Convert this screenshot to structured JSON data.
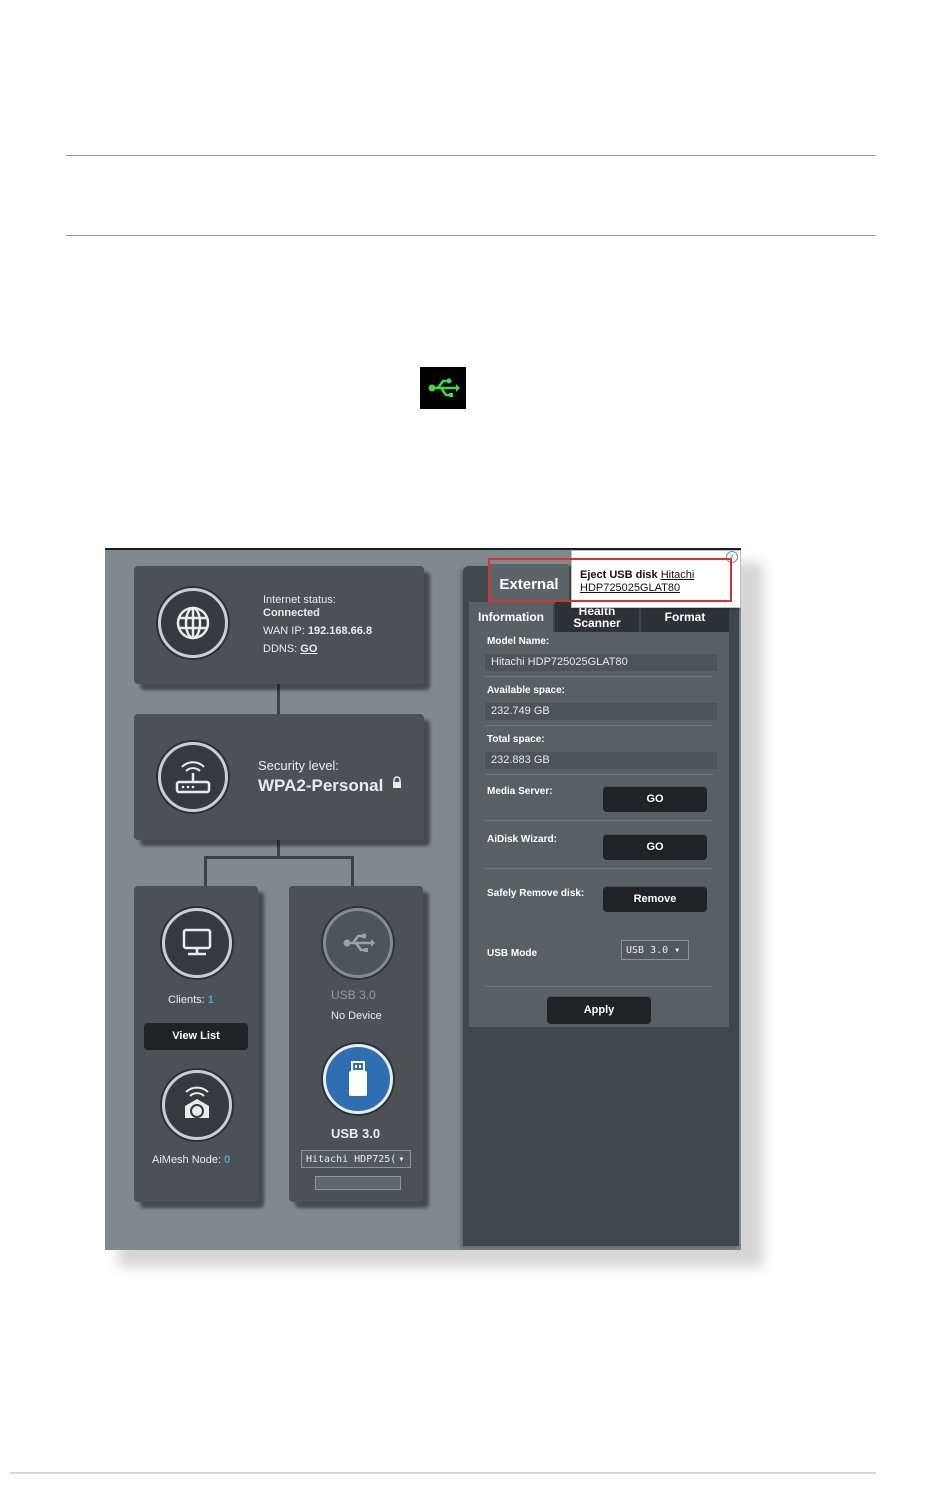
{
  "document": {
    "usb_icon": "usb-icon"
  },
  "network_map": {
    "internet": {
      "status_label": "Internet status:",
      "status_value": "Connected",
      "wan_label": "WAN IP:",
      "wan_value": "192.168.66.8",
      "ddns_label": "DDNS:",
      "ddns_value": "GO"
    },
    "router": {
      "security_label": "Security level:",
      "security_value": "WPA2-Personal"
    },
    "clients": {
      "label": "Clients:",
      "count": "1",
      "view_list": "View List"
    },
    "aimesh": {
      "label": "AiMesh Node:",
      "count": "0"
    },
    "usb_port_1": {
      "label": "USB 3.0",
      "status": "No Device"
    },
    "usb_port_2": {
      "label": "USB 3.0",
      "device_select": "Hitachi HDP725("
    }
  },
  "external": {
    "title": "External",
    "tooltip": {
      "action": "Eject USB disk",
      "device_name_1": "Hitachi",
      "device_name_2": "HDP725025GLAT80"
    },
    "tabs": [
      "Information",
      "Health Scanner",
      "Format"
    ],
    "fields": {
      "model_name_label": "Model Name:",
      "model_name_value": "Hitachi HDP725025GLAT80",
      "available_label": "Available space:",
      "available_value": "232.749 GB",
      "total_label": "Total space:",
      "total_value": "232.883 GB"
    },
    "actions": {
      "media_server_label": "Media Server:",
      "media_server_button": "GO",
      "aidisk_label": "AiDisk Wizard:",
      "aidisk_button": "GO",
      "remove_label": "Safely Remove disk:",
      "remove_button": "Remove",
      "usb_mode_label": "USB Mode",
      "usb_mode_value": "USB 3.0 ▾",
      "apply_button": "Apply"
    }
  },
  "colors": {
    "accent_blue": "#4aa3e0",
    "highlight_red": "#d9312e",
    "usb_green": "#3bdc3b"
  }
}
